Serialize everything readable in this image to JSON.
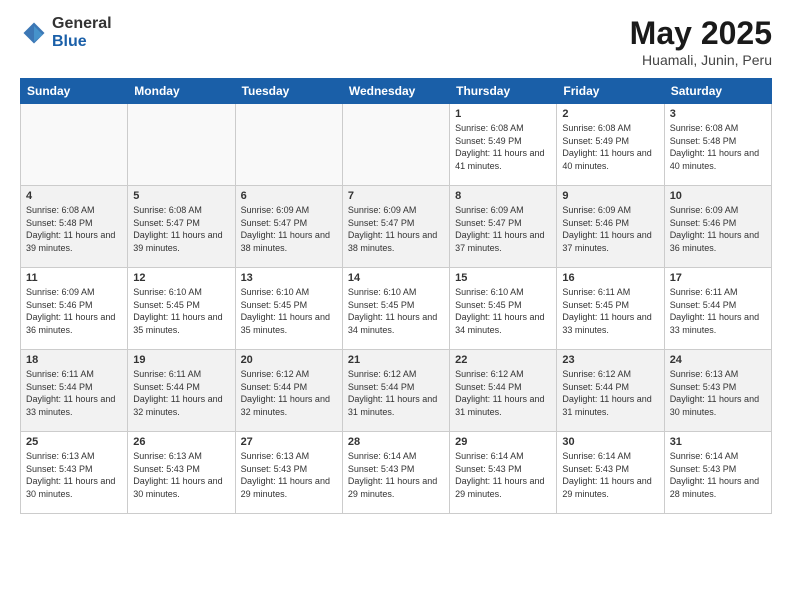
{
  "logo": {
    "general": "General",
    "blue": "Blue"
  },
  "header": {
    "month": "May 2025",
    "location": "Huamali, Junin, Peru"
  },
  "weekdays": [
    "Sunday",
    "Monday",
    "Tuesday",
    "Wednesday",
    "Thursday",
    "Friday",
    "Saturday"
  ],
  "weeks": [
    [
      {
        "day": "",
        "info": ""
      },
      {
        "day": "",
        "info": ""
      },
      {
        "day": "",
        "info": ""
      },
      {
        "day": "",
        "info": ""
      },
      {
        "day": "1",
        "info": "Sunrise: 6:08 AM\nSunset: 5:49 PM\nDaylight: 11 hours and 41 minutes."
      },
      {
        "day": "2",
        "info": "Sunrise: 6:08 AM\nSunset: 5:49 PM\nDaylight: 11 hours and 40 minutes."
      },
      {
        "day": "3",
        "info": "Sunrise: 6:08 AM\nSunset: 5:48 PM\nDaylight: 11 hours and 40 minutes."
      }
    ],
    [
      {
        "day": "4",
        "info": "Sunrise: 6:08 AM\nSunset: 5:48 PM\nDaylight: 11 hours and 39 minutes."
      },
      {
        "day": "5",
        "info": "Sunrise: 6:08 AM\nSunset: 5:47 PM\nDaylight: 11 hours and 39 minutes."
      },
      {
        "day": "6",
        "info": "Sunrise: 6:09 AM\nSunset: 5:47 PM\nDaylight: 11 hours and 38 minutes."
      },
      {
        "day": "7",
        "info": "Sunrise: 6:09 AM\nSunset: 5:47 PM\nDaylight: 11 hours and 38 minutes."
      },
      {
        "day": "8",
        "info": "Sunrise: 6:09 AM\nSunset: 5:47 PM\nDaylight: 11 hours and 37 minutes."
      },
      {
        "day": "9",
        "info": "Sunrise: 6:09 AM\nSunset: 5:46 PM\nDaylight: 11 hours and 37 minutes."
      },
      {
        "day": "10",
        "info": "Sunrise: 6:09 AM\nSunset: 5:46 PM\nDaylight: 11 hours and 36 minutes."
      }
    ],
    [
      {
        "day": "11",
        "info": "Sunrise: 6:09 AM\nSunset: 5:46 PM\nDaylight: 11 hours and 36 minutes."
      },
      {
        "day": "12",
        "info": "Sunrise: 6:10 AM\nSunset: 5:45 PM\nDaylight: 11 hours and 35 minutes."
      },
      {
        "day": "13",
        "info": "Sunrise: 6:10 AM\nSunset: 5:45 PM\nDaylight: 11 hours and 35 minutes."
      },
      {
        "day": "14",
        "info": "Sunrise: 6:10 AM\nSunset: 5:45 PM\nDaylight: 11 hours and 34 minutes."
      },
      {
        "day": "15",
        "info": "Sunrise: 6:10 AM\nSunset: 5:45 PM\nDaylight: 11 hours and 34 minutes."
      },
      {
        "day": "16",
        "info": "Sunrise: 6:11 AM\nSunset: 5:45 PM\nDaylight: 11 hours and 33 minutes."
      },
      {
        "day": "17",
        "info": "Sunrise: 6:11 AM\nSunset: 5:44 PM\nDaylight: 11 hours and 33 minutes."
      }
    ],
    [
      {
        "day": "18",
        "info": "Sunrise: 6:11 AM\nSunset: 5:44 PM\nDaylight: 11 hours and 33 minutes."
      },
      {
        "day": "19",
        "info": "Sunrise: 6:11 AM\nSunset: 5:44 PM\nDaylight: 11 hours and 32 minutes."
      },
      {
        "day": "20",
        "info": "Sunrise: 6:12 AM\nSunset: 5:44 PM\nDaylight: 11 hours and 32 minutes."
      },
      {
        "day": "21",
        "info": "Sunrise: 6:12 AM\nSunset: 5:44 PM\nDaylight: 11 hours and 31 minutes."
      },
      {
        "day": "22",
        "info": "Sunrise: 6:12 AM\nSunset: 5:44 PM\nDaylight: 11 hours and 31 minutes."
      },
      {
        "day": "23",
        "info": "Sunrise: 6:12 AM\nSunset: 5:44 PM\nDaylight: 11 hours and 31 minutes."
      },
      {
        "day": "24",
        "info": "Sunrise: 6:13 AM\nSunset: 5:43 PM\nDaylight: 11 hours and 30 minutes."
      }
    ],
    [
      {
        "day": "25",
        "info": "Sunrise: 6:13 AM\nSunset: 5:43 PM\nDaylight: 11 hours and 30 minutes."
      },
      {
        "day": "26",
        "info": "Sunrise: 6:13 AM\nSunset: 5:43 PM\nDaylight: 11 hours and 30 minutes."
      },
      {
        "day": "27",
        "info": "Sunrise: 6:13 AM\nSunset: 5:43 PM\nDaylight: 11 hours and 29 minutes."
      },
      {
        "day": "28",
        "info": "Sunrise: 6:14 AM\nSunset: 5:43 PM\nDaylight: 11 hours and 29 minutes."
      },
      {
        "day": "29",
        "info": "Sunrise: 6:14 AM\nSunset: 5:43 PM\nDaylight: 11 hours and 29 minutes."
      },
      {
        "day": "30",
        "info": "Sunrise: 6:14 AM\nSunset: 5:43 PM\nDaylight: 11 hours and 29 minutes."
      },
      {
        "day": "31",
        "info": "Sunrise: 6:14 AM\nSunset: 5:43 PM\nDaylight: 11 hours and 28 minutes."
      }
    ]
  ]
}
